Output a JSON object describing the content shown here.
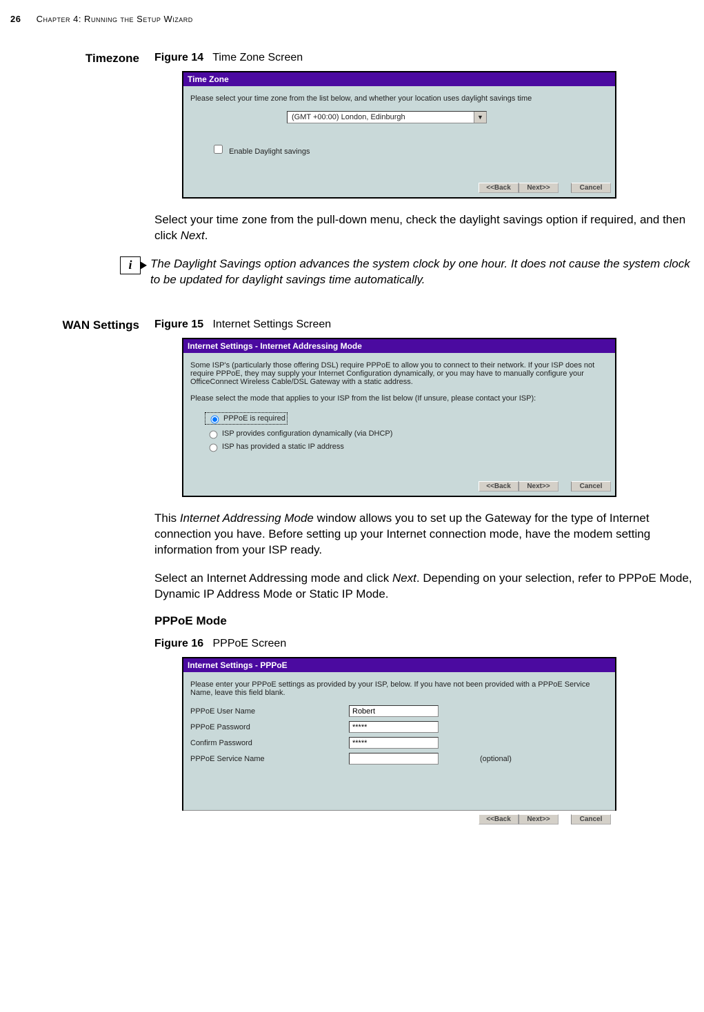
{
  "page": {
    "number": "26",
    "chapter": "Chapter 4: Running the Setup Wizard"
  },
  "sections": {
    "timezone": {
      "label": "Timezone",
      "figureLabel": "Figure 14",
      "figureTitle": "Time Zone Screen",
      "shot": {
        "title": "Time Zone",
        "intro": "Please select your time zone from the list below, and whether your location uses daylight savings time",
        "selected": "(GMT +00:00) London, Edinburgh",
        "daylight": "Enable Daylight savings",
        "buttons": {
          "back": "<<Back",
          "next": "Next>>",
          "cancel": "Cancel"
        }
      },
      "para1a": "Select your time zone from the pull-down menu, check the daylight savings option if required, and then click ",
      "para1b": "Next",
      "para1c": ".",
      "note": "The Daylight Savings option advances the system clock by one hour.  It does not cause the system clock to be updated for daylight savings time automatically."
    },
    "wan": {
      "label": "WAN Settings",
      "figureLabel": "Figure 15",
      "figureTitle": "Internet Settings Screen",
      "shot": {
        "title": "Internet Settings - Internet Addressing Mode",
        "intro1": "Some ISP's (particularly those offering DSL) require PPPoE to allow you to connect to their network. If your ISP does not require PPPoE, they may supply your Internet Configuration dynamically, or you may have to manually configure your OfficeConnect Wireless Cable/DSL Gateway with a static address.",
        "intro2": "Please select the mode that applies to your ISP from the list below (If unsure, please contact your ISP):",
        "r1": "PPPoE is required",
        "r2": "ISP provides configuration dynamically (via DHCP)",
        "r3": "ISP has provided a static IP address",
        "buttons": {
          "back": "<<Back",
          "next": "Next>>",
          "cancel": "Cancel"
        }
      },
      "para1a": "This ",
      "para1b": "Internet Addressing Mode",
      "para1c": " window allows you to set up the Gateway for the type of Internet connection you have. Before setting up your Internet connection mode, have the modem setting information from your ISP ready.",
      "para2a": "Select an Internet Addressing mode and click ",
      "para2b": "Next",
      "para2c": ".  Depending on your selection, refer to PPPoE Mode, Dynamic IP Address Mode or Static IP Mode."
    },
    "pppoe": {
      "heading": "PPPoE Mode",
      "figureLabel": "Figure 16",
      "figureTitle": "PPPoE Screen",
      "shot": {
        "title": "Internet Settings - PPPoE",
        "intro": "Please enter your PPPoE settings as provided by your ISP, below. If you have not been provided with a PPPoE Service Name, leave this field blank.",
        "userLabel": "PPPoE User Name",
        "userVal": "Robert",
        "passLabel": "PPPoE Password",
        "passVal": "*****",
        "confLabel": "Confirm Password",
        "confVal": "*****",
        "svcLabel": "PPPoE Service Name",
        "svcVal": "",
        "optional": "(optional)",
        "buttons": {
          "back": "<<Back",
          "next": "Next>>",
          "cancel": "Cancel"
        }
      }
    }
  },
  "icons": {
    "info": "i"
  }
}
